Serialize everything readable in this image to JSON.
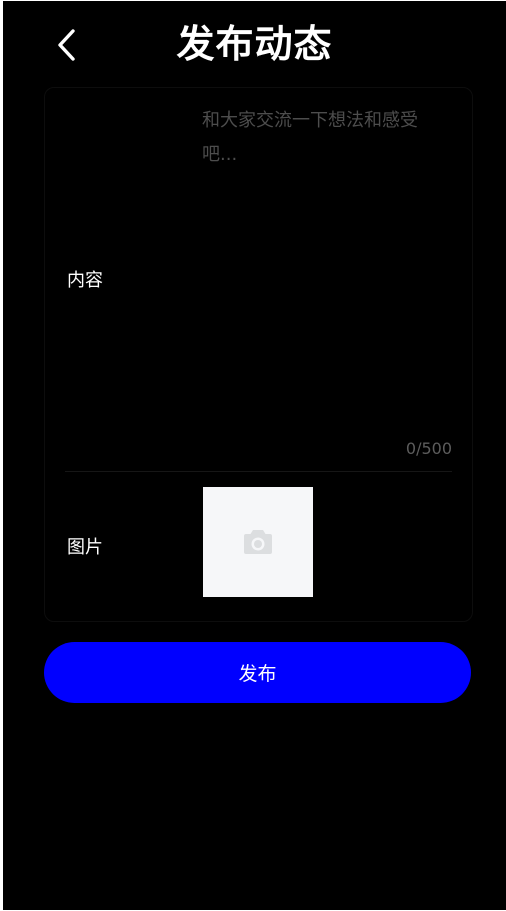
{
  "header": {
    "title": "发布动态",
    "back_icon": "chevron-left-icon"
  },
  "form": {
    "content_label": "内容",
    "content_value": "",
    "content_placeholder": "和大家交流一下想法和感受吧...",
    "char_counter": "0/500",
    "image_label": "图片",
    "upload_icon": "camera-icon"
  },
  "actions": {
    "publish_label": "发布"
  },
  "colors": {
    "background": "#000000",
    "primary_button": "#0000ff",
    "placeholder": "#4d4d4d",
    "uploader_bg": "#f6f7f9",
    "camera_icon": "#dcdee0"
  }
}
